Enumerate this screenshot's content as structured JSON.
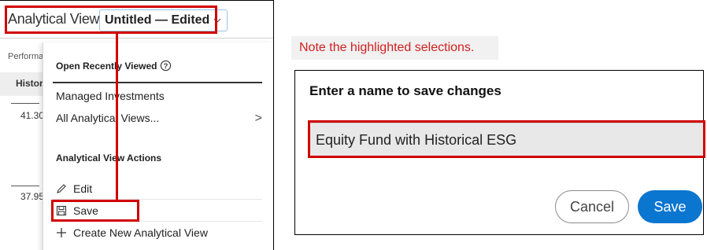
{
  "header": {
    "label": "Analytical View:",
    "view_name": "Untitled — Edited"
  },
  "background": {
    "performance": "Performa",
    "historical": "Histori",
    "value1": "41.30",
    "value2": "37.95"
  },
  "menu": {
    "recent_heading": "Open Recently Viewed",
    "items_top": [
      {
        "label": "Managed Investments"
      },
      {
        "label": "All Analytical Views...",
        "chevron": ">"
      }
    ],
    "actions_heading": "Analytical View Actions",
    "actions": [
      {
        "label": "Edit",
        "icon": "pencil-icon"
      },
      {
        "label": "Save",
        "icon": "floppy-icon"
      },
      {
        "label": "Create New Analytical View",
        "icon": "plus-icon"
      }
    ]
  },
  "note": "Note the highlighted selections.",
  "dialog": {
    "title": "Enter a name to save changes",
    "input_value": "Equity Fund with Historical ESG",
    "cancel_label": "Cancel",
    "save_label": "Save"
  },
  "colors": {
    "highlight": "#d00000",
    "primary_button": "#0a76d0",
    "note_text": "#d21f1f"
  }
}
